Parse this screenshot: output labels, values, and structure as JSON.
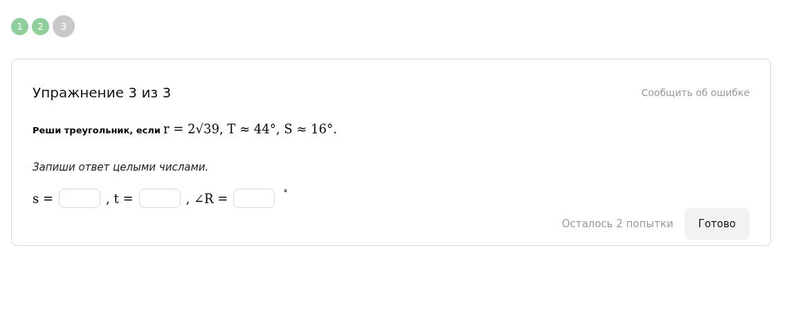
{
  "steps": [
    {
      "label": "1",
      "done": true,
      "selected": false
    },
    {
      "label": "2",
      "done": true,
      "selected": false
    },
    {
      "label": "3",
      "done": false,
      "selected": true
    }
  ],
  "card": {
    "title": "Упражнение 3 из 3",
    "report_link": "Сообщить об ошибке",
    "prompt": "Реши треугольник, если",
    "condition": "r = 2√39, T ≈ 44°, S ≈ 16°.",
    "instruction": "Запиши ответ целыми числами.",
    "blanks": [
      {
        "label": "s ="
      },
      {
        "label": ", t ="
      },
      {
        "label": ", ∠R ="
      }
    ],
    "unit": "°",
    "attempts": "Осталось 2 попытки",
    "submit": "Готово"
  }
}
